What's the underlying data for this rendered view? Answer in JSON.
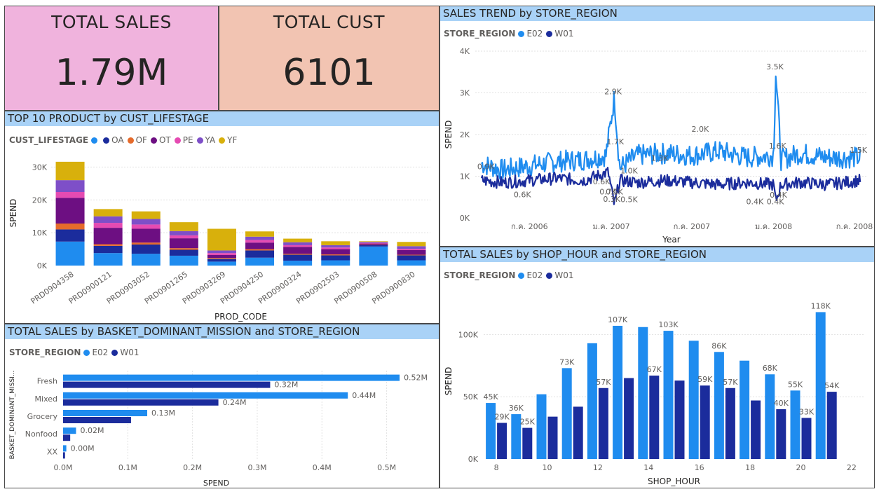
{
  "colors": {
    "title_bar": "#a9d2f7",
    "kpi_sales_bg": "#f0b3dd",
    "kpi_cust_bg": "#f2c4b2",
    "E02": "#1f8cef",
    "W01": "#1b2c9c",
    "OA_blue": "#1f8cef",
    "OA": "#1b2c9c",
    "OF": "#e56b2c",
    "OT": "#6d0f82",
    "PE": "#e54bb2",
    "YA": "#7e4fc8",
    "YF": "#d8b00c"
  },
  "kpis": {
    "sales": {
      "label": "TOTAL SALES",
      "value": "1.79M"
    },
    "cust": {
      "label": "TOTAL CUST",
      "value": "6101"
    }
  },
  "top10": {
    "title": "TOP 10 PRODUCT by CUST_LIFESTAGE",
    "legend_title": "CUST_LIFESTAGE",
    "legend_items": [
      {
        "label": "",
        "color_key": "OA_blue"
      },
      {
        "label": "OA",
        "color_key": "OA"
      },
      {
        "label": "OF",
        "color_key": "OF"
      },
      {
        "label": "OT",
        "color_key": "OT"
      },
      {
        "label": "PE",
        "color_key": "PE"
      },
      {
        "label": "YA",
        "color_key": "YA"
      },
      {
        "label": "YF",
        "color_key": "YF"
      }
    ]
  },
  "trend": {
    "title": "SALES TREND by STORE_REGION",
    "legend_title": "STORE_REGION",
    "legend_items": [
      {
        "label": "E02",
        "color_key": "E02"
      },
      {
        "label": "W01",
        "color_key": "W01"
      }
    ]
  },
  "hour": {
    "title": "TOTAL SALES by SHOP_HOUR and STORE_REGION",
    "legend_title": "STORE_REGION",
    "legend_items": [
      {
        "label": "E02",
        "color_key": "E02"
      },
      {
        "label": "W01",
        "color_key": "W01"
      }
    ]
  },
  "mission": {
    "title": "TOTAL SALES by BASKET_DOMINANT_MISSION and STORE_REGION",
    "legend_title": "STORE_REGION",
    "legend_items": [
      {
        "label": "E02",
        "color_key": "E02"
      },
      {
        "label": "W01",
        "color_key": "W01"
      }
    ]
  },
  "chart_data": [
    {
      "id": "top10",
      "type": "bar",
      "stacked": true,
      "xlabel": "PROD_CODE",
      "ylabel": "SPEND",
      "ylim": [
        0,
        32000
      ],
      "yticks": [
        0,
        10000,
        20000,
        30000
      ],
      "ytick_labels": [
        "0K",
        "10K",
        "20K",
        "30K"
      ],
      "categories": [
        "PRD0904358",
        "PRD0900121",
        "PRD0903052",
        "PRD0901265",
        "PRD0903269",
        "PRD0904250",
        "PRD0900324",
        "PRD0902503",
        "PRD0900508",
        "PRD0900830"
      ],
      "series": [
        {
          "color_key": "OA_blue",
          "values": [
            7300,
            3800,
            3600,
            3000,
            1200,
            2400,
            1500,
            1600,
            5800,
            1600
          ]
        },
        {
          "name": "OA",
          "color_key": "OA",
          "values": [
            3700,
            2200,
            2800,
            1800,
            800,
            2200,
            1800,
            1500,
            400,
            1500
          ]
        },
        {
          "name": "OF",
          "color_key": "OF",
          "values": [
            1800,
            500,
            600,
            500,
            300,
            400,
            300,
            300,
            100,
            200
          ]
        },
        {
          "name": "OT",
          "color_key": "OT",
          "values": [
            7800,
            5000,
            4200,
            3000,
            900,
            2000,
            2100,
            1600,
            400,
            1400
          ]
        },
        {
          "name": "PE",
          "color_key": "PE",
          "values": [
            1800,
            1500,
            1300,
            900,
            600,
            800,
            500,
            500,
            200,
            400
          ]
        },
        {
          "name": "YA",
          "color_key": "YA",
          "values": [
            3600,
            2000,
            1700,
            1300,
            800,
            1000,
            900,
            700,
            300,
            800
          ]
        },
        {
          "name": "YF",
          "color_key": "YF",
          "values": [
            5600,
            2200,
            2300,
            2700,
            6600,
            1600,
            1100,
            1200,
            200,
            1300
          ]
        }
      ]
    },
    {
      "id": "trend",
      "type": "line",
      "xlabel": "Year",
      "ylabel": "SPEND",
      "ylim": [
        0,
        4000
      ],
      "yticks": [
        0,
        1000,
        2000,
        3000,
        4000
      ],
      "ytick_labels": [
        "0K",
        "1K",
        "2K",
        "3K",
        "4K"
      ],
      "xlim": [
        "2006-03-01",
        "2008-07-31"
      ],
      "xticks": [
        "2006-07-01",
        "2007-01-01",
        "2007-07-01",
        "2008-01-01",
        "2008-07-01"
      ],
      "xtick_labels": [
        "ก.ค. 2006",
        "ม.ค. 2007",
        "ก.ค. 2007",
        "ม.ค. 2008",
        "ก.ค. 2008"
      ],
      "series": [
        {
          "name": "E02",
          "color_key": "E02",
          "keypoints": [
            [
              "2006-03-15",
              1300
            ],
            [
              "2006-05-01",
              1150
            ],
            [
              "2006-07-01",
              1250
            ],
            [
              "2006-09-01",
              1350
            ],
            [
              "2006-11-01",
              1400
            ],
            [
              "2006-12-20",
              1500
            ],
            [
              "2007-01-08",
              2900
            ],
            [
              "2007-01-20",
              1200
            ],
            [
              "2007-03-01",
              1500
            ],
            [
              "2007-05-01",
              1550
            ],
            [
              "2007-07-01",
              1500
            ],
            [
              "2007-09-01",
              1600
            ],
            [
              "2007-11-01",
              1450
            ],
            [
              "2008-01-01",
              1500
            ],
            [
              "2008-01-06",
              3500
            ],
            [
              "2008-01-18",
              1400
            ],
            [
              "2008-03-01",
              1550
            ],
            [
              "2008-05-01",
              1450
            ],
            [
              "2008-07-15",
              1450
            ]
          ],
          "noise": 260
        },
        {
          "name": "W01",
          "color_key": "W01",
          "keypoints": [
            [
              "2006-03-15",
              900
            ],
            [
              "2006-05-01",
              850
            ],
            [
              "2006-07-01",
              900
            ],
            [
              "2006-09-01",
              950
            ],
            [
              "2006-11-01",
              900
            ],
            [
              "2006-12-25",
              1100
            ],
            [
              "2007-01-08",
              300
            ],
            [
              "2007-01-20",
              900
            ],
            [
              "2007-03-01",
              850
            ],
            [
              "2007-05-01",
              900
            ],
            [
              "2007-07-01",
              850
            ],
            [
              "2007-09-01",
              800
            ],
            [
              "2007-11-01",
              850
            ],
            [
              "2008-01-01",
              800
            ],
            [
              "2008-01-06",
              400
            ],
            [
              "2008-01-18",
              800
            ],
            [
              "2008-03-01",
              850
            ],
            [
              "2008-05-01",
              800
            ],
            [
              "2008-07-15",
              900
            ]
          ],
          "noise": 150
        }
      ],
      "annotations": [
        {
          "x": "2007-01-05",
          "y": 2900,
          "text": "2.9K",
          "series": "E02"
        },
        {
          "x": "2008-01-04",
          "y": 3500,
          "text": "3.5K",
          "series": "E02"
        },
        {
          "x": "2007-07-20",
          "y": 2000,
          "text": "2.0K",
          "series": "E02"
        },
        {
          "x": "2008-07-10",
          "y": 1500,
          "text": "1.5K",
          "series": "E02"
        },
        {
          "x": "2007-01-10",
          "y": 1700,
          "text": "1.7K",
          "series": "E02"
        },
        {
          "x": "2008-01-10",
          "y": 1600,
          "text": "1.6K",
          "series": "E02"
        },
        {
          "x": "2006-03-25",
          "y": 1100,
          "text": "0.9K",
          "series": "E02"
        },
        {
          "x": "2007-02-10",
          "y": 1000,
          "text": "1.0K",
          "series": "E02"
        },
        {
          "x": "2007-04-20",
          "y": 1300,
          "text": "1.3K",
          "series": "E02"
        },
        {
          "x": "2006-12-10",
          "y": 740,
          "text": "0.6K",
          "series": "W01"
        },
        {
          "x": "2006-12-25",
          "y": 500,
          "text": "0.7K",
          "series": "W01"
        },
        {
          "x": "2007-01-08",
          "y": 500,
          "text": "0.5K",
          "series": "W01"
        },
        {
          "x": "2006-06-15",
          "y": 430,
          "text": "0.6K",
          "series": "W01"
        },
        {
          "x": "2007-01-02",
          "y": 320,
          "text": "0.3K",
          "series": "W01"
        },
        {
          "x": "2007-02-10",
          "y": 310,
          "text": "0.5K",
          "series": "W01"
        },
        {
          "x": "2007-11-20",
          "y": 260,
          "text": "0.4K",
          "series": "W01"
        },
        {
          "x": "2008-01-05",
          "y": 260,
          "text": "0.4K",
          "series": "W01"
        },
        {
          "x": "2008-01-12",
          "y": 420,
          "text": "0.4K",
          "series": "W01"
        }
      ]
    },
    {
      "id": "hour",
      "type": "bar",
      "xlabel": "SHOP_HOUR",
      "ylabel": "SPEND",
      "ylim": [
        0,
        125000
      ],
      "yticks": [
        0,
        50000,
        100000
      ],
      "ytick_labels": [
        "0K",
        "50K",
        "100K"
      ],
      "xtick_labels": [
        "8",
        "10",
        "12",
        "14",
        "16",
        "18",
        "20",
        "22"
      ],
      "categories": [
        8,
        9,
        10,
        11,
        12,
        13,
        14,
        15,
        16,
        17,
        18,
        19,
        20,
        21
      ],
      "series": [
        {
          "name": "E02",
          "color_key": "E02",
          "values": [
            45000,
            36000,
            52000,
            73000,
            93000,
            107000,
            106000,
            103000,
            95000,
            86000,
            79000,
            68000,
            55000,
            118000
          ],
          "labels": [
            "45K",
            "36K",
            "",
            "73K",
            "",
            "107K",
            "",
            "103K",
            "",
            "86K",
            "",
            "68K",
            "55K",
            "118K"
          ]
        },
        {
          "name": "W01",
          "color_key": "W01",
          "values": [
            29000,
            25000,
            34000,
            42000,
            57000,
            65000,
            67000,
            63000,
            59000,
            57000,
            47000,
            40000,
            33000,
            54000
          ],
          "labels": [
            "29K",
            "25K",
            "",
            "",
            "57K",
            "",
            "67K",
            "",
            "59K",
            "57K",
            "",
            "40K",
            "33K",
            "54K"
          ]
        }
      ]
    },
    {
      "id": "mission",
      "type": "bar",
      "orientation": "horizontal",
      "xlabel": "SPEND",
      "ylabel": "BASKET_DOMINANT_MISSI...",
      "xlim": [
        0,
        0.56
      ],
      "xticks": [
        0,
        0.1,
        0.2,
        0.3,
        0.4,
        0.5
      ],
      "xtick_labels": [
        "0.0M",
        "0.1M",
        "0.2M",
        "0.3M",
        "0.4M",
        "0.5M"
      ],
      "categories": [
        "Fresh",
        "Mixed",
        "Grocery",
        "Nonfood",
        "XX"
      ],
      "series": [
        {
          "name": "E02",
          "color_key": "E02",
          "values": [
            0.52,
            0.44,
            0.13,
            0.02,
            0.005
          ],
          "labels": [
            "0.52M",
            "0.44M",
            "0.13M",
            "0.02M",
            "0.00M"
          ]
        },
        {
          "name": "W01",
          "color_key": "W01",
          "values": [
            0.32,
            0.24,
            0.105,
            0.011,
            0.003
          ],
          "labels": [
            "0.32M",
            "0.24M",
            "",
            "",
            ""
          ]
        }
      ]
    }
  ]
}
